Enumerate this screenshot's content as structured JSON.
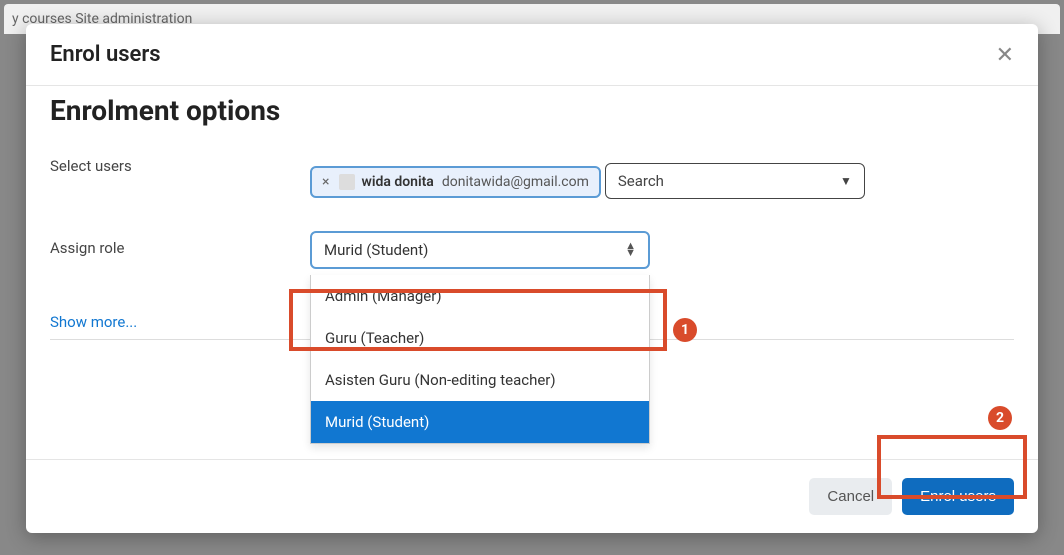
{
  "bg_nav_text": "y courses   Site administration",
  "modal": {
    "title": "Enrol users",
    "section_title": "Enrolment options",
    "select_users_label": "Select users",
    "user_chip": {
      "name": "wida donita",
      "email": "donitawida@gmail.com"
    },
    "search_placeholder": "Search",
    "assign_role_label": "Assign role",
    "role_selected": "Murid (Student)",
    "role_options": [
      "Admin (Manager)",
      "Guru (Teacher)",
      "Asisten Guru (Non-editing teacher)",
      "Murid (Student)"
    ],
    "show_more": "Show more...",
    "cancel_button": "Cancel",
    "enrol_button": "Enrol users"
  },
  "annotations": {
    "one": "1",
    "two": "2"
  }
}
